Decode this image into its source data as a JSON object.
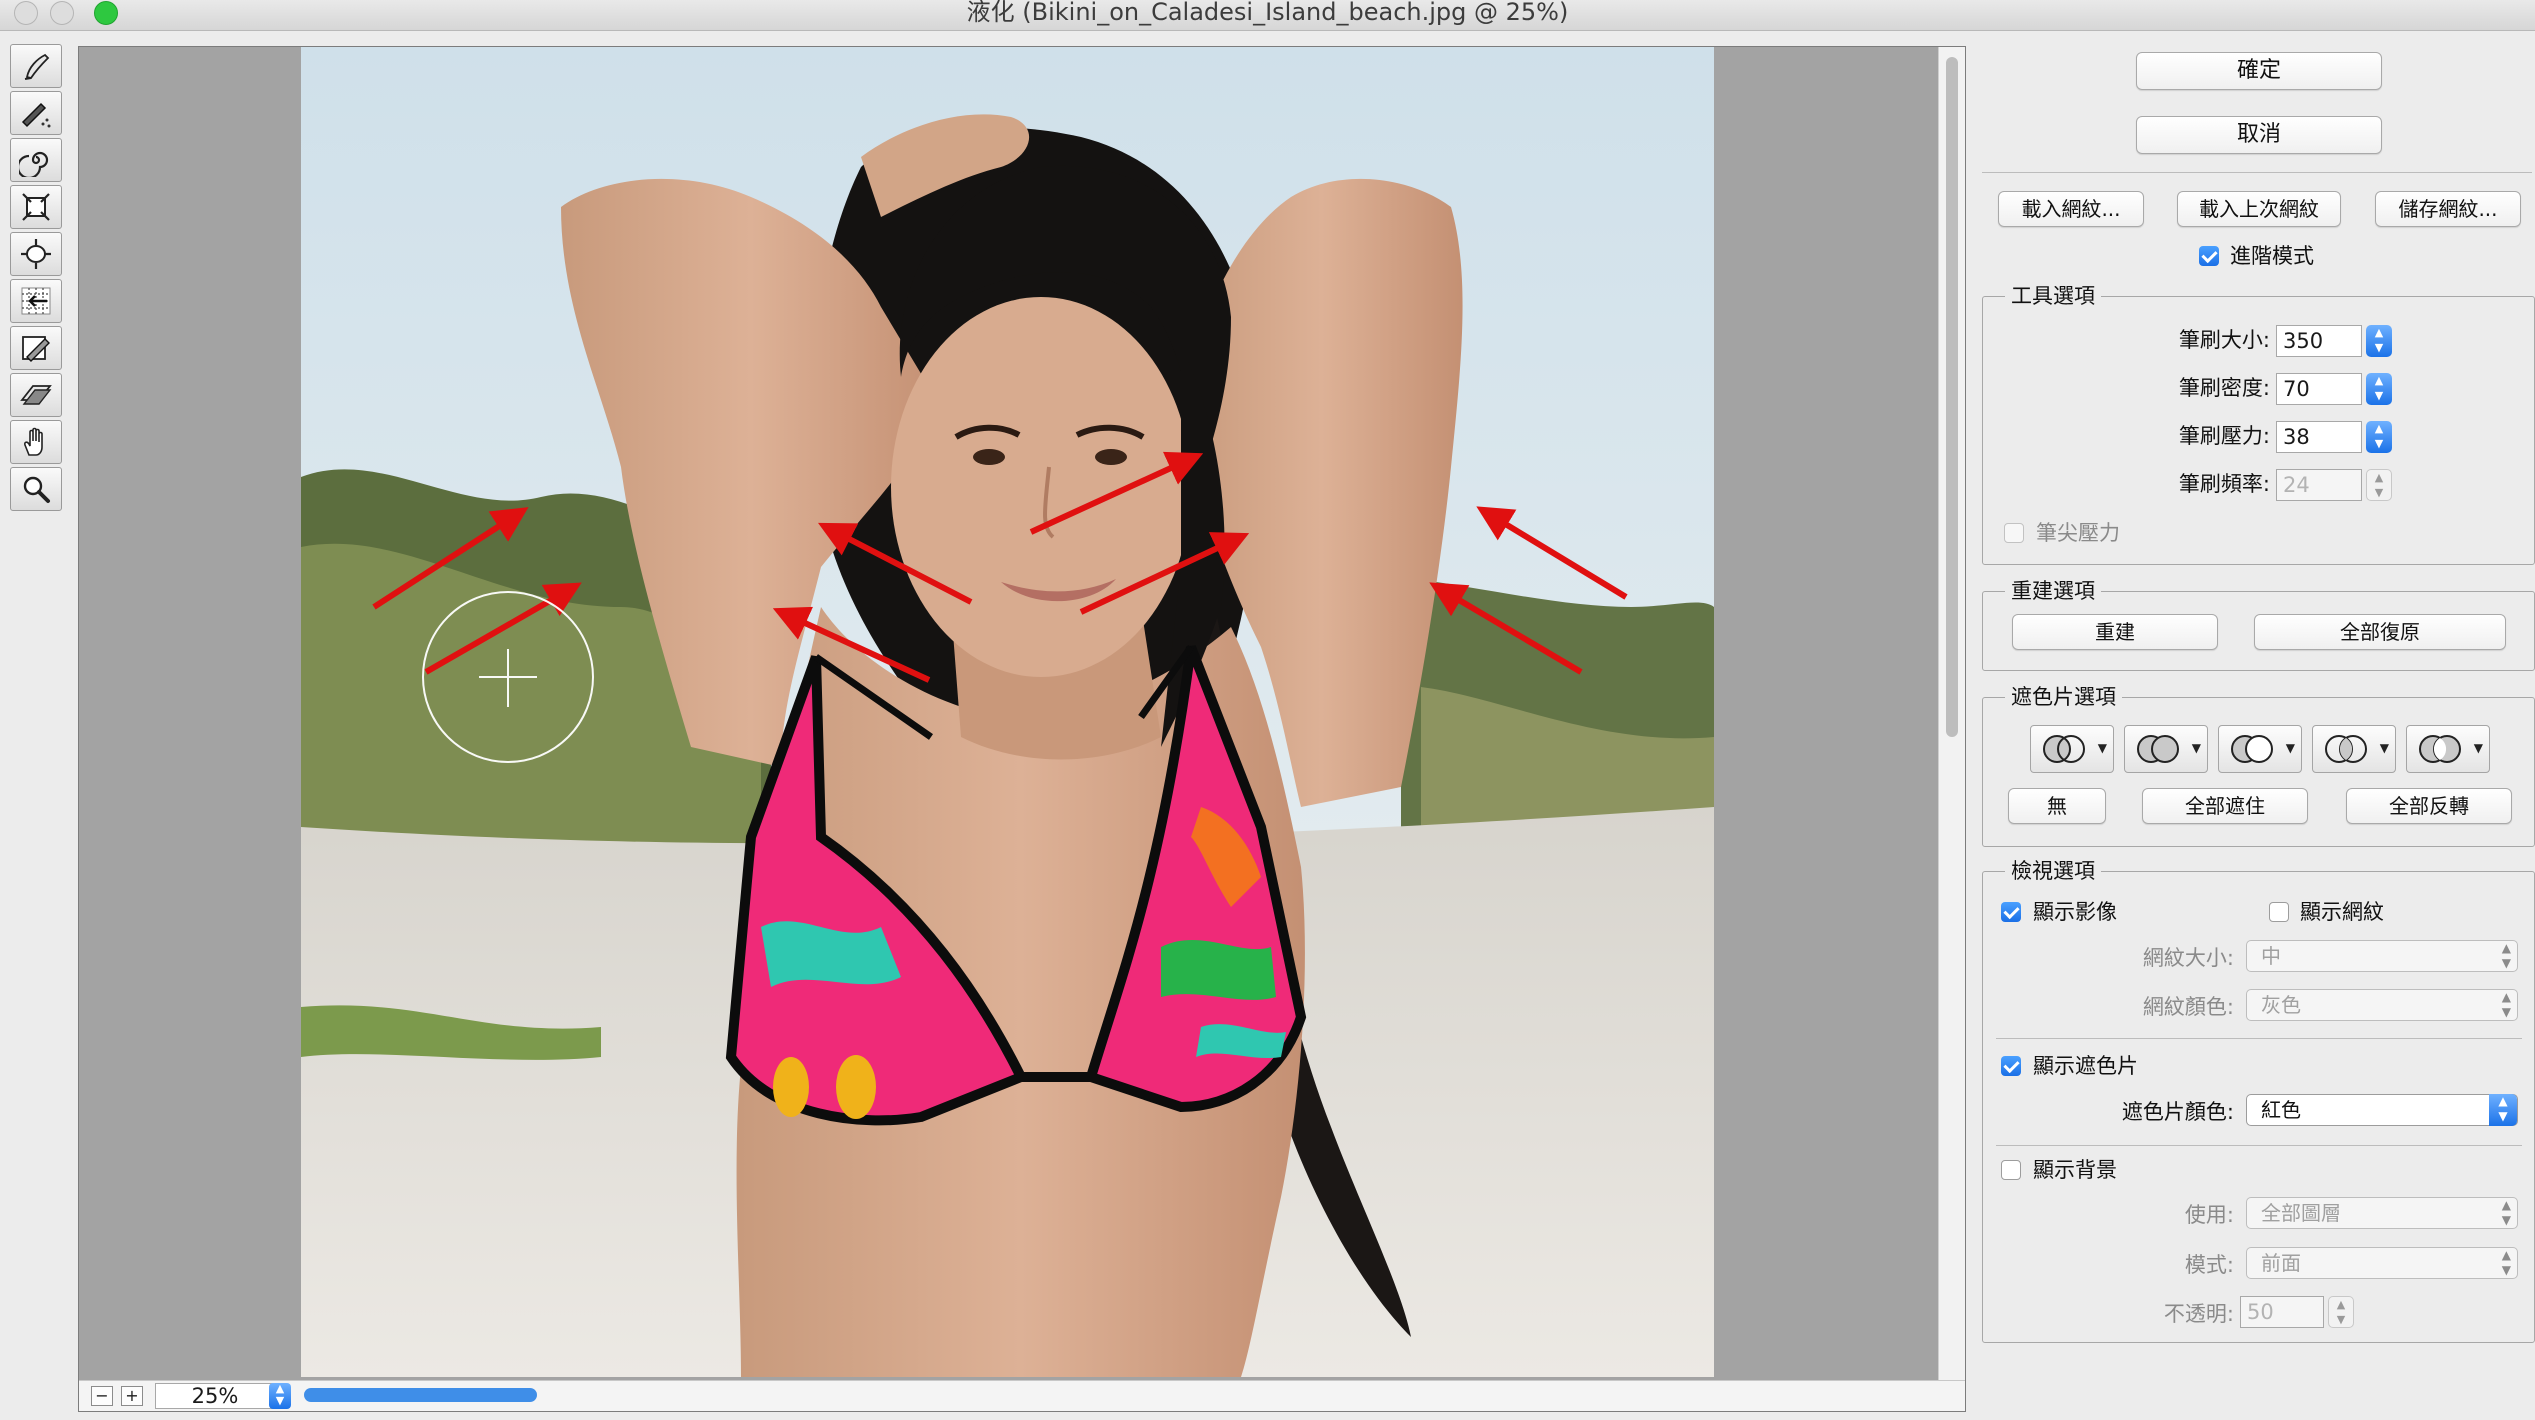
{
  "window": {
    "title": "液化 (Bikini_on_Caladesi_Island_beach.jpg @ 25%)"
  },
  "toolbar": {
    "tools": [
      "forward-warp-tool-icon",
      "reconstruct-tool-icon",
      "twirl-clockwise-tool-icon",
      "pucker-tool-icon",
      "bloat-tool-icon",
      "push-left-tool-icon",
      "freeze-mask-tool-icon",
      "thaw-mask-tool-icon",
      "hand-tool-icon",
      "zoom-tool-icon"
    ]
  },
  "status": {
    "zoom": "25%",
    "zoom_out": "−",
    "zoom_in": "+"
  },
  "buttons": {
    "ok": "確定",
    "cancel": "取消",
    "load_mesh": "載入網紋...",
    "load_last_mesh": "載入上次網紋",
    "save_mesh": "儲存網紋..."
  },
  "advanced_mode": {
    "label": "進階模式",
    "checked": true
  },
  "tool_options": {
    "title": "工具選項",
    "brush_size": {
      "label": "筆刷大小:",
      "value": "350"
    },
    "brush_density": {
      "label": "筆刷密度:",
      "value": "70"
    },
    "brush_pressure": {
      "label": "筆刷壓力:",
      "value": "38"
    },
    "brush_rate": {
      "label": "筆刷頻率:",
      "value": "24"
    },
    "stylus_pressure": {
      "label": "筆尖壓力",
      "checked": false
    }
  },
  "reconstruct_options": {
    "title": "重建選項",
    "reconstruct": "重建",
    "restore_all": "全部復原"
  },
  "mask_options": {
    "title": "遮色片選項",
    "none": "無",
    "mask_all": "全部遮住",
    "invert_all": "全部反轉"
  },
  "view_options": {
    "title": "檢視選項",
    "show_image": {
      "label": "顯示影像",
      "checked": true
    },
    "show_mesh": {
      "label": "顯示網紋",
      "checked": false
    },
    "mesh_size": {
      "label": "網紋大小:",
      "value": "中"
    },
    "mesh_color": {
      "label": "網紋顏色:",
      "value": "灰色"
    },
    "show_mask": {
      "label": "顯示遮色片",
      "checked": true
    },
    "mask_color": {
      "label": "遮色片顏色:",
      "value": "紅色"
    },
    "show_backdrop": {
      "label": "顯示背景",
      "checked": false
    },
    "use": {
      "label": "使用:",
      "value": "全部圖層"
    },
    "mode": {
      "label": "模式:",
      "value": "前面"
    },
    "opacity": {
      "label": "不透明:",
      "value": "50"
    }
  },
  "colors": {
    "accent": "#1b72e8",
    "annotation_arrow": "#e01010",
    "canvas_bg": "#a3a3a3"
  }
}
